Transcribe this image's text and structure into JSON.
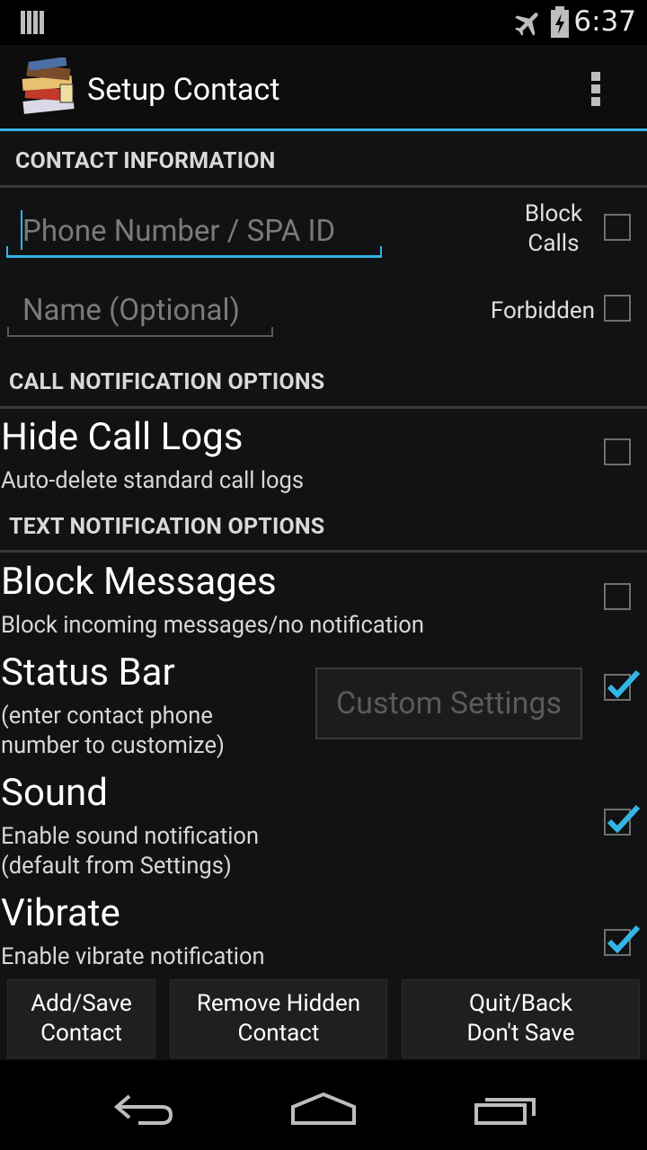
{
  "status_bar": {
    "time": "6:37"
  },
  "action_bar": {
    "title": "Setup Contact"
  },
  "sections": {
    "contact_info": "CONTACT INFORMATION",
    "call_options": "CALL NOTIFICATION OPTIONS",
    "text_options": "TEXT NOTIFICATION OPTIONS"
  },
  "contact": {
    "phone_placeholder": "Phone Number / SPA ID",
    "name_placeholder": "Name (Optional)",
    "block_calls_label": "Block Calls",
    "block_calls_line1": "Block",
    "block_calls_line2": "Calls",
    "forbidden_label": "Forbidden"
  },
  "options": {
    "hide_call_logs": {
      "title": "Hide Call Logs",
      "subtitle": "Auto-delete standard call logs",
      "checked": false
    },
    "block_messages": {
      "title": "Block Messages",
      "subtitle": "Block incoming messages/no notification",
      "checked": false
    },
    "status_bar": {
      "title": "Status Bar",
      "subtitle_line1": "(enter contact phone",
      "subtitle_line2": "number to customize)",
      "button": "Custom Settings",
      "checked": true
    },
    "sound": {
      "title": "Sound",
      "subtitle_line1": "Enable sound notification",
      "subtitle_line2": "(default from Settings)",
      "checked": true
    },
    "vibrate": {
      "title": "Vibrate",
      "subtitle": "Enable vibrate notification",
      "checked": true
    }
  },
  "buttons": {
    "add_save_line1": "Add/Save",
    "add_save_line2": "Contact",
    "remove_line1": "Remove Hidden",
    "remove_line2": "Contact",
    "quit_line1": "Quit/Back",
    "quit_line2": "Don't Save"
  },
  "colors": {
    "accent": "#33b5e5",
    "background": "#111213"
  }
}
